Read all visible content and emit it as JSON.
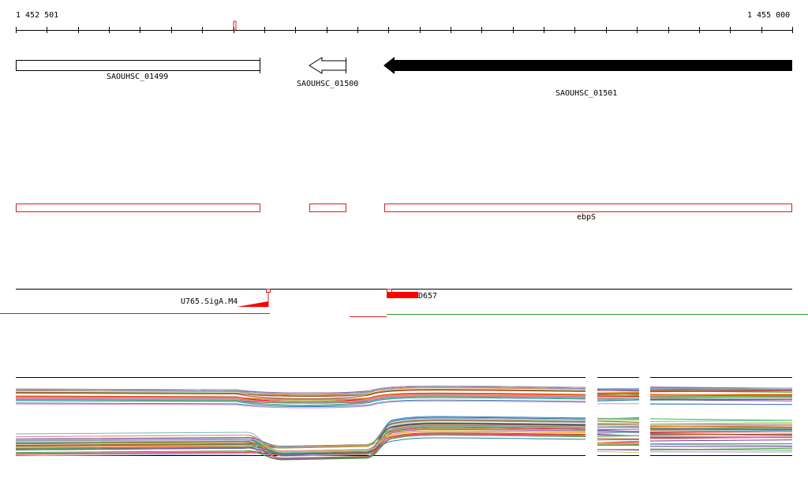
{
  "ruler": {
    "start_label": "1 452 501",
    "end_label": "1 455 000"
  },
  "genes": [
    {
      "name": "SAOUHSC_01499",
      "strand": "none",
      "style": "outline"
    },
    {
      "name": "SAOUHSC_01500",
      "strand": "-",
      "style": "outline"
    },
    {
      "name": "SAOUHSC_01501",
      "strand": "-",
      "style": "filled"
    }
  ],
  "annotations": {
    "segments": 3,
    "label": "ebpS"
  },
  "features": {
    "left_label": "U765.SigA.M4",
    "right_label": "D657"
  },
  "colors": {
    "annotation": "#d81e1e",
    "feature_fill": "#ff0000",
    "coverage_green": "#2ca02c",
    "gene_fill": "#000000"
  }
}
